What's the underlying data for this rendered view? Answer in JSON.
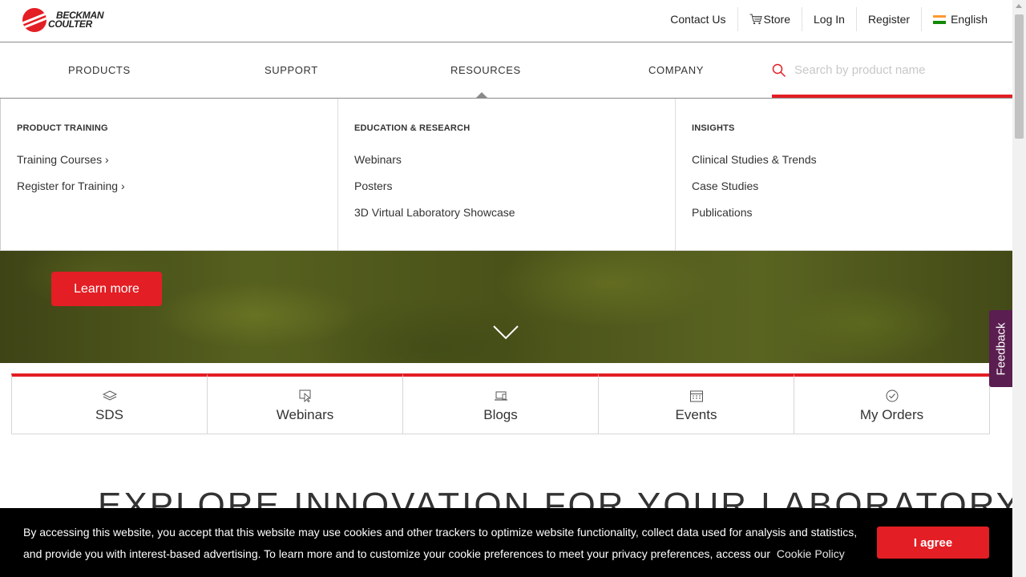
{
  "brand": {
    "logo_line1": "BECKMAN",
    "logo_line2": "COULTER",
    "color": "#e31e24"
  },
  "utility_nav": {
    "contact": "Contact Us",
    "store": "Store",
    "login": "Log In",
    "register": "Register",
    "language": "English"
  },
  "main_nav": {
    "items": [
      "PRODUCTS",
      "SUPPORT",
      "RESOURCES",
      "COMPANY"
    ],
    "active": "RESOURCES",
    "search_placeholder": "Search by product name"
  },
  "mega_menu": {
    "columns": [
      {
        "heading": "PRODUCT TRAINING",
        "links": [
          "Training Courses ›",
          "Register for Training ›"
        ]
      },
      {
        "heading": "EDUCATION & RESEARCH",
        "links": [
          "Webinars",
          "Posters",
          "3D Virtual Laboratory Showcase"
        ]
      },
      {
        "heading": "INSIGHTS",
        "links": [
          "Clinical Studies & Trends",
          "Case Studies",
          "Publications"
        ]
      }
    ]
  },
  "hero": {
    "button_label": "Learn more"
  },
  "quick_links": [
    {
      "label": "SDS",
      "icon": "layers-icon"
    },
    {
      "label": "Webinars",
      "icon": "cursor-screen-icon"
    },
    {
      "label": "Blogs",
      "icon": "laptop-icon"
    },
    {
      "label": "Events",
      "icon": "calendar-icon"
    },
    {
      "label": "My Orders",
      "icon": "check-circle-icon"
    }
  ],
  "section_heading": "EXPLORE INNOVATION FOR YOUR LABORATORY",
  "feedback_label": "Feedback",
  "cookie_banner": {
    "text": "By accessing this website, you accept that this website may use cookies and other trackers to optimize website functionality, collect data used for analysis and statistics, and provide you with interest-based advertising. To learn more and to customize your cookie preferences to meet your privacy preferences, access our",
    "link": "Cookie Policy",
    "button": "I agree"
  }
}
